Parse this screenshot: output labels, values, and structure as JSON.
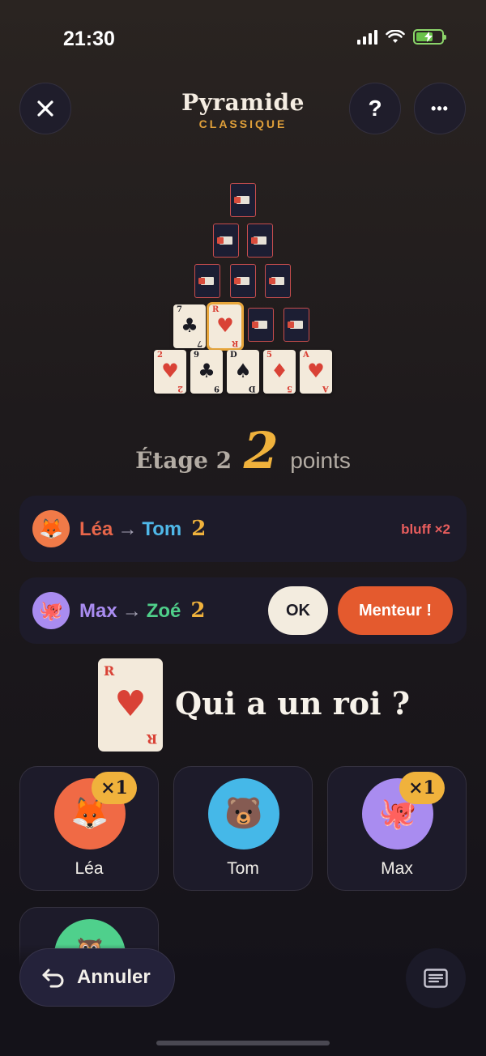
{
  "status": {
    "time": "21:30"
  },
  "header": {
    "title": "Pyramide",
    "subtitle": "CLASSIQUE",
    "close_icon": "close-icon",
    "help_label": "?",
    "more_label": "•••"
  },
  "pyramid": {
    "face_cards": [
      {
        "rank": "7",
        "suit": "♣",
        "color": "black",
        "row": 4
      },
      {
        "rank": "R",
        "suit": "♥",
        "color": "red",
        "row": 4,
        "selected": true
      },
      {
        "rank": "2",
        "suit": "♥",
        "color": "red",
        "row": 5
      },
      {
        "rank": "9",
        "suit": "♣",
        "color": "black",
        "row": 5
      },
      {
        "rank": "D",
        "suit": "♠",
        "color": "black",
        "row": 5
      },
      {
        "rank": "5",
        "suit": "♦",
        "color": "red",
        "row": 5
      },
      {
        "rank": "A",
        "suit": "♥",
        "color": "red",
        "row": 5
      }
    ]
  },
  "etage": {
    "label": "Étage 2",
    "points": "2",
    "points_label": "points"
  },
  "claims": [
    {
      "from": "Léa",
      "to": "Tom",
      "points": "2",
      "from_color": "#e8664a",
      "to_color": "#4fb8e8",
      "avatar": "🦊",
      "avatar_bg": "#f07a48",
      "note": "bluff ×2"
    },
    {
      "from": "Max",
      "to": "Zoé",
      "points": "2",
      "from_color": "#a98cf0",
      "to_color": "#4fcf8a",
      "avatar": "🐙",
      "avatar_bg": "#a98cf0",
      "ok_label": "OK",
      "liar_label": "Menteur !"
    }
  ],
  "question": {
    "card_rank": "R",
    "card_suit": "♥",
    "text": "Qui a un roi ?"
  },
  "players": [
    {
      "name": "Léa",
      "avatar": "🦊",
      "bg": "#f06a45",
      "mult": "×1"
    },
    {
      "name": "Tom",
      "avatar": "🐻",
      "bg": "#45b8e8"
    },
    {
      "name": "Max",
      "avatar": "🐙",
      "bg": "#a98cf0",
      "mult": "×1"
    },
    {
      "name": "",
      "avatar": "🦉",
      "bg": "#4fd08c"
    }
  ],
  "footer": {
    "undo_label": "Annuler",
    "arrow": "↶"
  },
  "colors": {
    "accent": "#f0b23c",
    "danger": "#e45a2e",
    "panel": "#1d1b2a"
  }
}
